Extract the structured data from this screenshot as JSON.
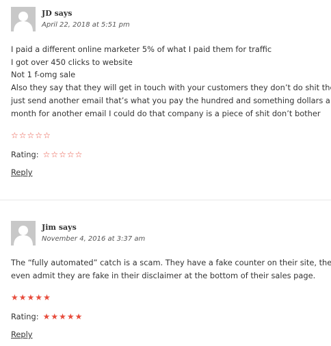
{
  "comments": [
    {
      "author": "JD says",
      "date": "April 22, 2018 at 5:51 pm",
      "lines": [
        "I paid a different online marketer 5% of what I paid them for traffic",
        "I got over 450 clicks to website",
        "Not 1 f-omg sale",
        "Also they say that they will get in touch with your customers they don’t do shit they",
        "just send another email that’s what you pay the hundred and something dollars a",
        "month for another email I could do that company is a piece of shit don’t bother"
      ],
      "stars_rating": 0,
      "stars_max": 5,
      "rating_label": "Rating:",
      "rating_value": 0,
      "reply_label": "Reply"
    },
    {
      "author": "Jim says",
      "date": "November 4, 2016 at 3:37 am",
      "lines": [
        "The “fully automated” catch is a scam. They have a fake counter on their site, they",
        "even admit they are fake in their disclaimer at the bottom of their sales page."
      ],
      "stars_rating": 5,
      "stars_max": 5,
      "rating_label": "Rating:",
      "rating_value": 5,
      "reply_label": "Reply"
    }
  ],
  "colors": {
    "star": "#e74c3c",
    "avatar_bg": "#c8c8c8",
    "text": "#333333"
  }
}
